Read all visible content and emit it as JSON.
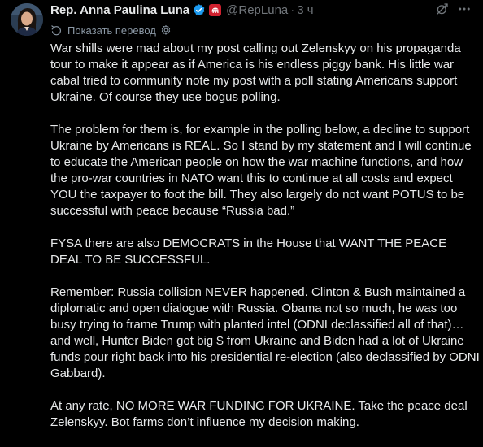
{
  "author": {
    "name": "Rep. Anna Paulina Luna",
    "handle": "@RepLuna",
    "separator": "·",
    "time": "3 ч"
  },
  "translation": {
    "label": "Показать перевод"
  },
  "post": {
    "paragraphs": [
      "War shills were mad about my post calling out Zelenskyy on his propaganda tour to make it appear as if America is his endless piggy bank. His little war cabal tried to community note my post with a poll stating Americans support Ukraine. Of course they use bogus polling.",
      "The problem for them is, for example in the polling below, a decline to support Ukraine by Americans is REAL. So I stand by my statement and I will continue to educate the American people on how the war machine functions, and how the pro-war countries in NATO want this to continue at all costs and expect YOU the taxpayer to foot the bill. They also largely do not want POTUS to be successful with peace because “Russia bad.”",
      "FYSA there are also DEMOCRATS in the House that WANT THE PEACE DEAL TO BE SUCCESSFUL.",
      "Remember: Russia collision NEVER happened. Clinton & Bush maintained a diplomatic and open dialogue with Russia. Obama not so much, he was too busy trying to frame Trump with planted intel (ODNI declassified all of that)… and well, Hunter Biden got big $ from Ukraine and Biden had a lot of Ukraine funds pour right back into his presidential re-election (also declassified by ODNI Gabbard).",
      "At any rate, NO MORE WAR FUNDING FOR UKRAINE. Take the peace deal Zelenskyy. Bot farms don’t influence my decision making."
    ]
  },
  "icons": {
    "verified": "verified-badge-icon",
    "party": "republican-elephant-icon",
    "grok": "grok-icon",
    "more": "more-dots-icon",
    "translate": "translate-icon",
    "settings": "gear-icon"
  },
  "colors": {
    "background": "#000000",
    "text": "#e7e9ea",
    "secondary": "#71767b",
    "verified": "#1d9bf0",
    "party": "#d0212f"
  }
}
